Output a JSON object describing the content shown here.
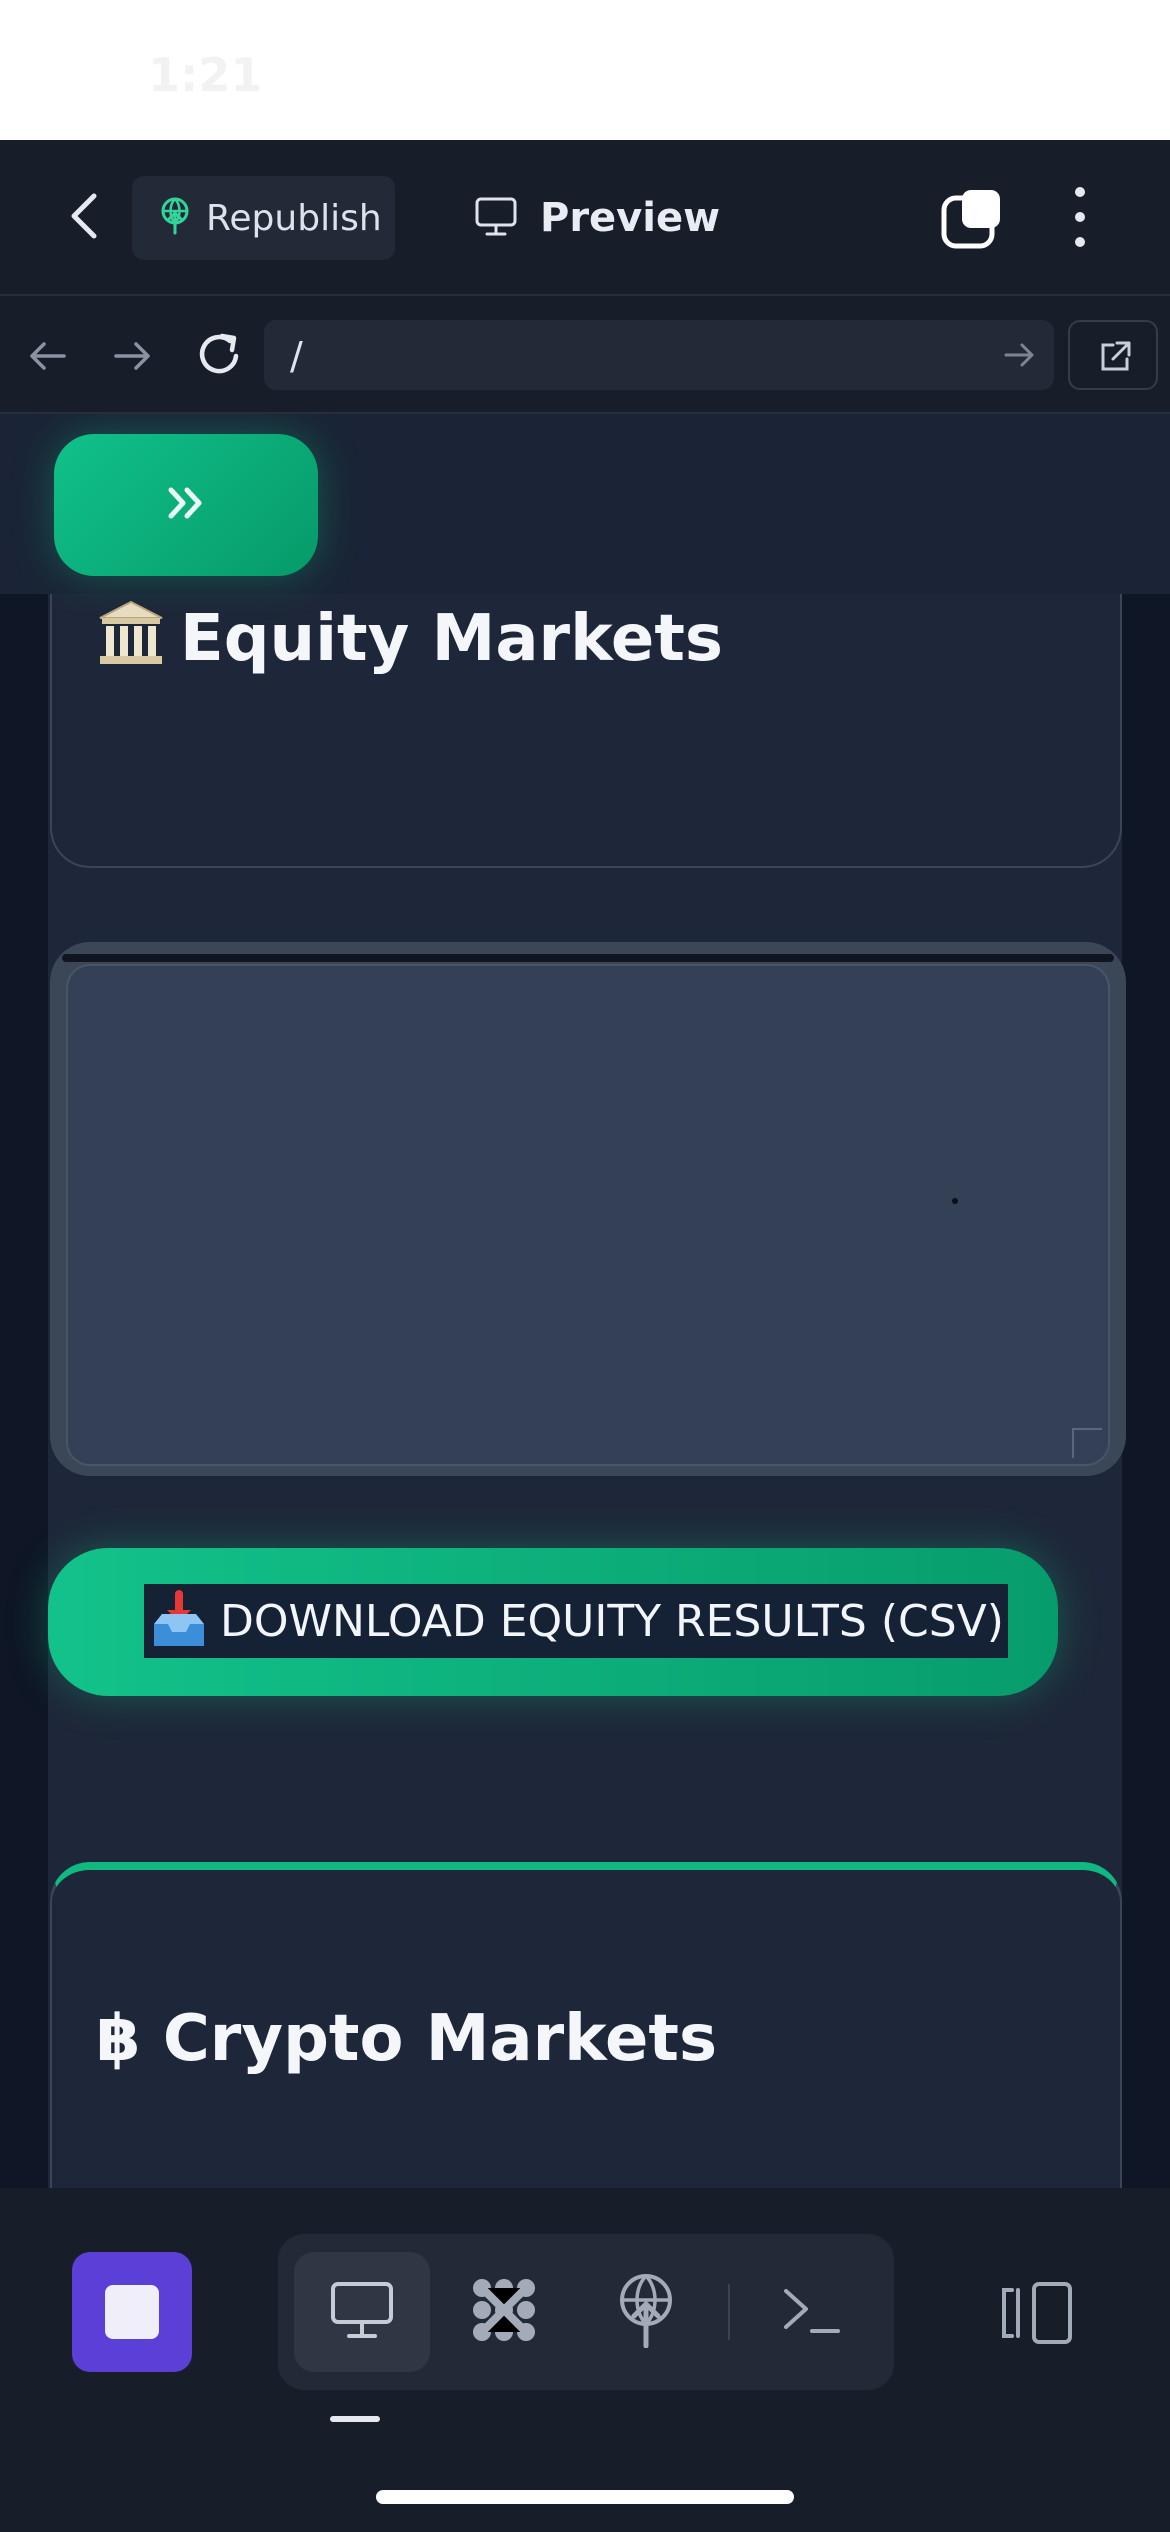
{
  "status": {
    "time": "1:21"
  },
  "toolbar": {
    "republish_label": "Republish",
    "preview_label": "Preview"
  },
  "browser": {
    "url": "/"
  },
  "sections": {
    "equity": {
      "title": "Equity Markets",
      "download_label": "DOWNLOAD EQUITY RESULTS (CSV)"
    },
    "crypto": {
      "title": "฿ Crypto Markets"
    }
  },
  "colors": {
    "accent": "#10b981",
    "stop": "#5b3fd6",
    "background": "#0f1626",
    "card": "#1e2739"
  },
  "icons": {
    "back": "chevron-left-icon",
    "republish": "republish-globe-icon",
    "preview": "monitor-icon",
    "tabs": "tabs-icon",
    "more": "more-vertical-icon",
    "nav_back": "arrow-left-icon",
    "nav_forward": "arrow-right-icon",
    "reload": "reload-icon",
    "external": "external-link-icon",
    "sidebar_toggle": "double-chevron-right-icon",
    "equity": "bank-icon",
    "download": "inbox-tray-icon",
    "stop": "stop-icon",
    "desktop": "monitor-icon",
    "workflow": "nodes-icon",
    "deploy": "globe-upload-icon",
    "shell": "terminal-icon",
    "device": "device-toggle-icon"
  }
}
